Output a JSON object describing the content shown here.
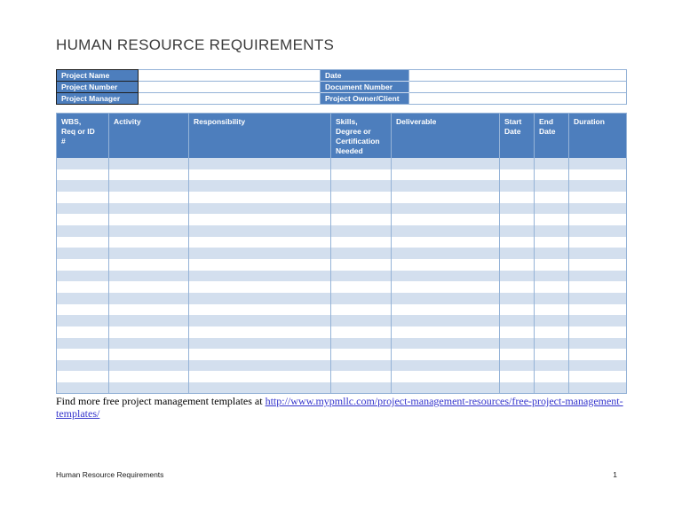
{
  "page": {
    "title": "HUMAN RESOURCE REQUIREMENTS"
  },
  "info_form": {
    "rows": [
      {
        "left_label": "Project Name",
        "left_value": "",
        "right_label": "Date",
        "right_value": ""
      },
      {
        "left_label": "Project Number",
        "left_value": "",
        "right_label": "Document Number",
        "right_value": ""
      },
      {
        "left_label": "Project Manager",
        "left_value": "",
        "right_label": "Project Owner/Client",
        "right_value": ""
      }
    ]
  },
  "main_table": {
    "columns": [
      "WBS,\nReq or ID\n#",
      "Activity",
      "Responsibility",
      "Skills,\nDegree or\nCertification\nNeeded",
      "Deliverable",
      "Start\nDate",
      "End\nDate",
      "Duration"
    ],
    "empty_row_count": 21
  },
  "promo": {
    "text": "Find more free project management templates at ",
    "link_text": "http://www.mypmllc.com/project-management-resources/free-project-management-templates/"
  },
  "page_footer": {
    "left": "Human Resource Requirements",
    "right": "1"
  },
  "colors": {
    "header_blue": "#4d7ebd",
    "stripe_blue": "#d3dfee",
    "border_blue": "#95b3d7",
    "label_border_dark": "#1f1f1f",
    "link_blue": "#3333cc"
  }
}
